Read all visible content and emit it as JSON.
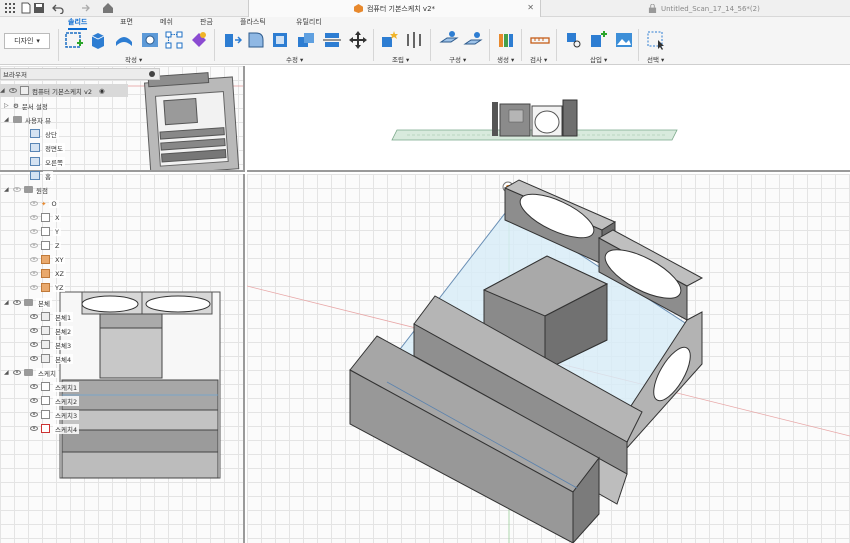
{
  "titlebar": {
    "active_tab": "컴퓨터 기본스케치 v2*",
    "inactive_tab": "Untitled_Scan_17_14_56*(2)"
  },
  "ribbon": {
    "workspace": "디자인",
    "tabs": [
      "솔리드",
      "표면",
      "메쉬",
      "판금",
      "플라스틱",
      "유틸리티"
    ],
    "groups": [
      "작성",
      "수정",
      "조립",
      "구성",
      "생성",
      "검사",
      "삽입",
      "선택"
    ]
  },
  "browser": {
    "title": "브라우저",
    "doc_name": "컴퓨터 기본스케치 v2",
    "items": {
      "doc_settings": "문서 설정",
      "named_views": "사용자 뷰",
      "view_top": "상단",
      "view_front": "정면도",
      "view_right": "오른쪽",
      "view_home": "홈",
      "origin": "원점",
      "origin_o": "O",
      "origin_x": "X",
      "origin_y": "Y",
      "origin_z": "Z",
      "origin_xy": "XY",
      "origin_xz": "XZ",
      "origin_yz": "YZ",
      "bodies": "본체",
      "body1": "본체1",
      "body2": "본체2",
      "body3": "본체3",
      "body4": "본체4",
      "sketches": "스케치",
      "sketch1": "스케치1",
      "sketch2": "스케치2",
      "sketch3": "스케치3",
      "sketch4": "스케치4"
    }
  },
  "colors": {
    "accent": "#0a6ad1",
    "model_fill": "#9d9d9d",
    "model_dark": "#6e6e6e",
    "sketch_fill": "#cfe8f7"
  }
}
